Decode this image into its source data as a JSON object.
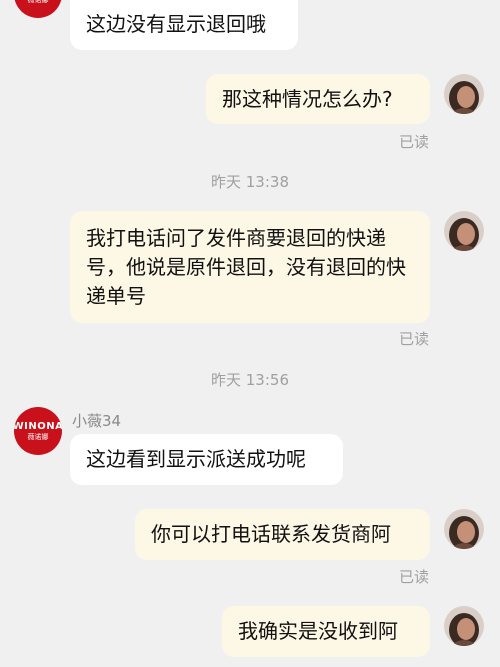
{
  "contact": {
    "name": "小薇34",
    "avatar_text": "WINONA",
    "avatar_sub": "薇诺娜"
  },
  "messages": [
    {
      "side": "left",
      "text": "这边没有显示退回哦"
    },
    {
      "side": "right",
      "text": "那这种情况怎么办?",
      "status": "已读"
    },
    {
      "side": "right",
      "text": "我打电话问了发件商要退回的快递号，他说是原件退回，没有退回的快递单号",
      "status": "已读"
    },
    {
      "side": "left",
      "text": "这边看到显示派送成功呢"
    },
    {
      "side": "right",
      "text": "你可以打电话联系发货商阿",
      "status": "已读"
    },
    {
      "side": "right",
      "text": "我确实是没收到阿"
    }
  ],
  "timestamps": [
    "昨天 13:38",
    "昨天 13:56"
  ],
  "colors": {
    "background": "#f0f0f0",
    "left_bubble": "#ffffff",
    "right_bubble": "#fdf7e6",
    "brand_red": "#c8111b",
    "meta_gray": "#a0a0a0"
  }
}
